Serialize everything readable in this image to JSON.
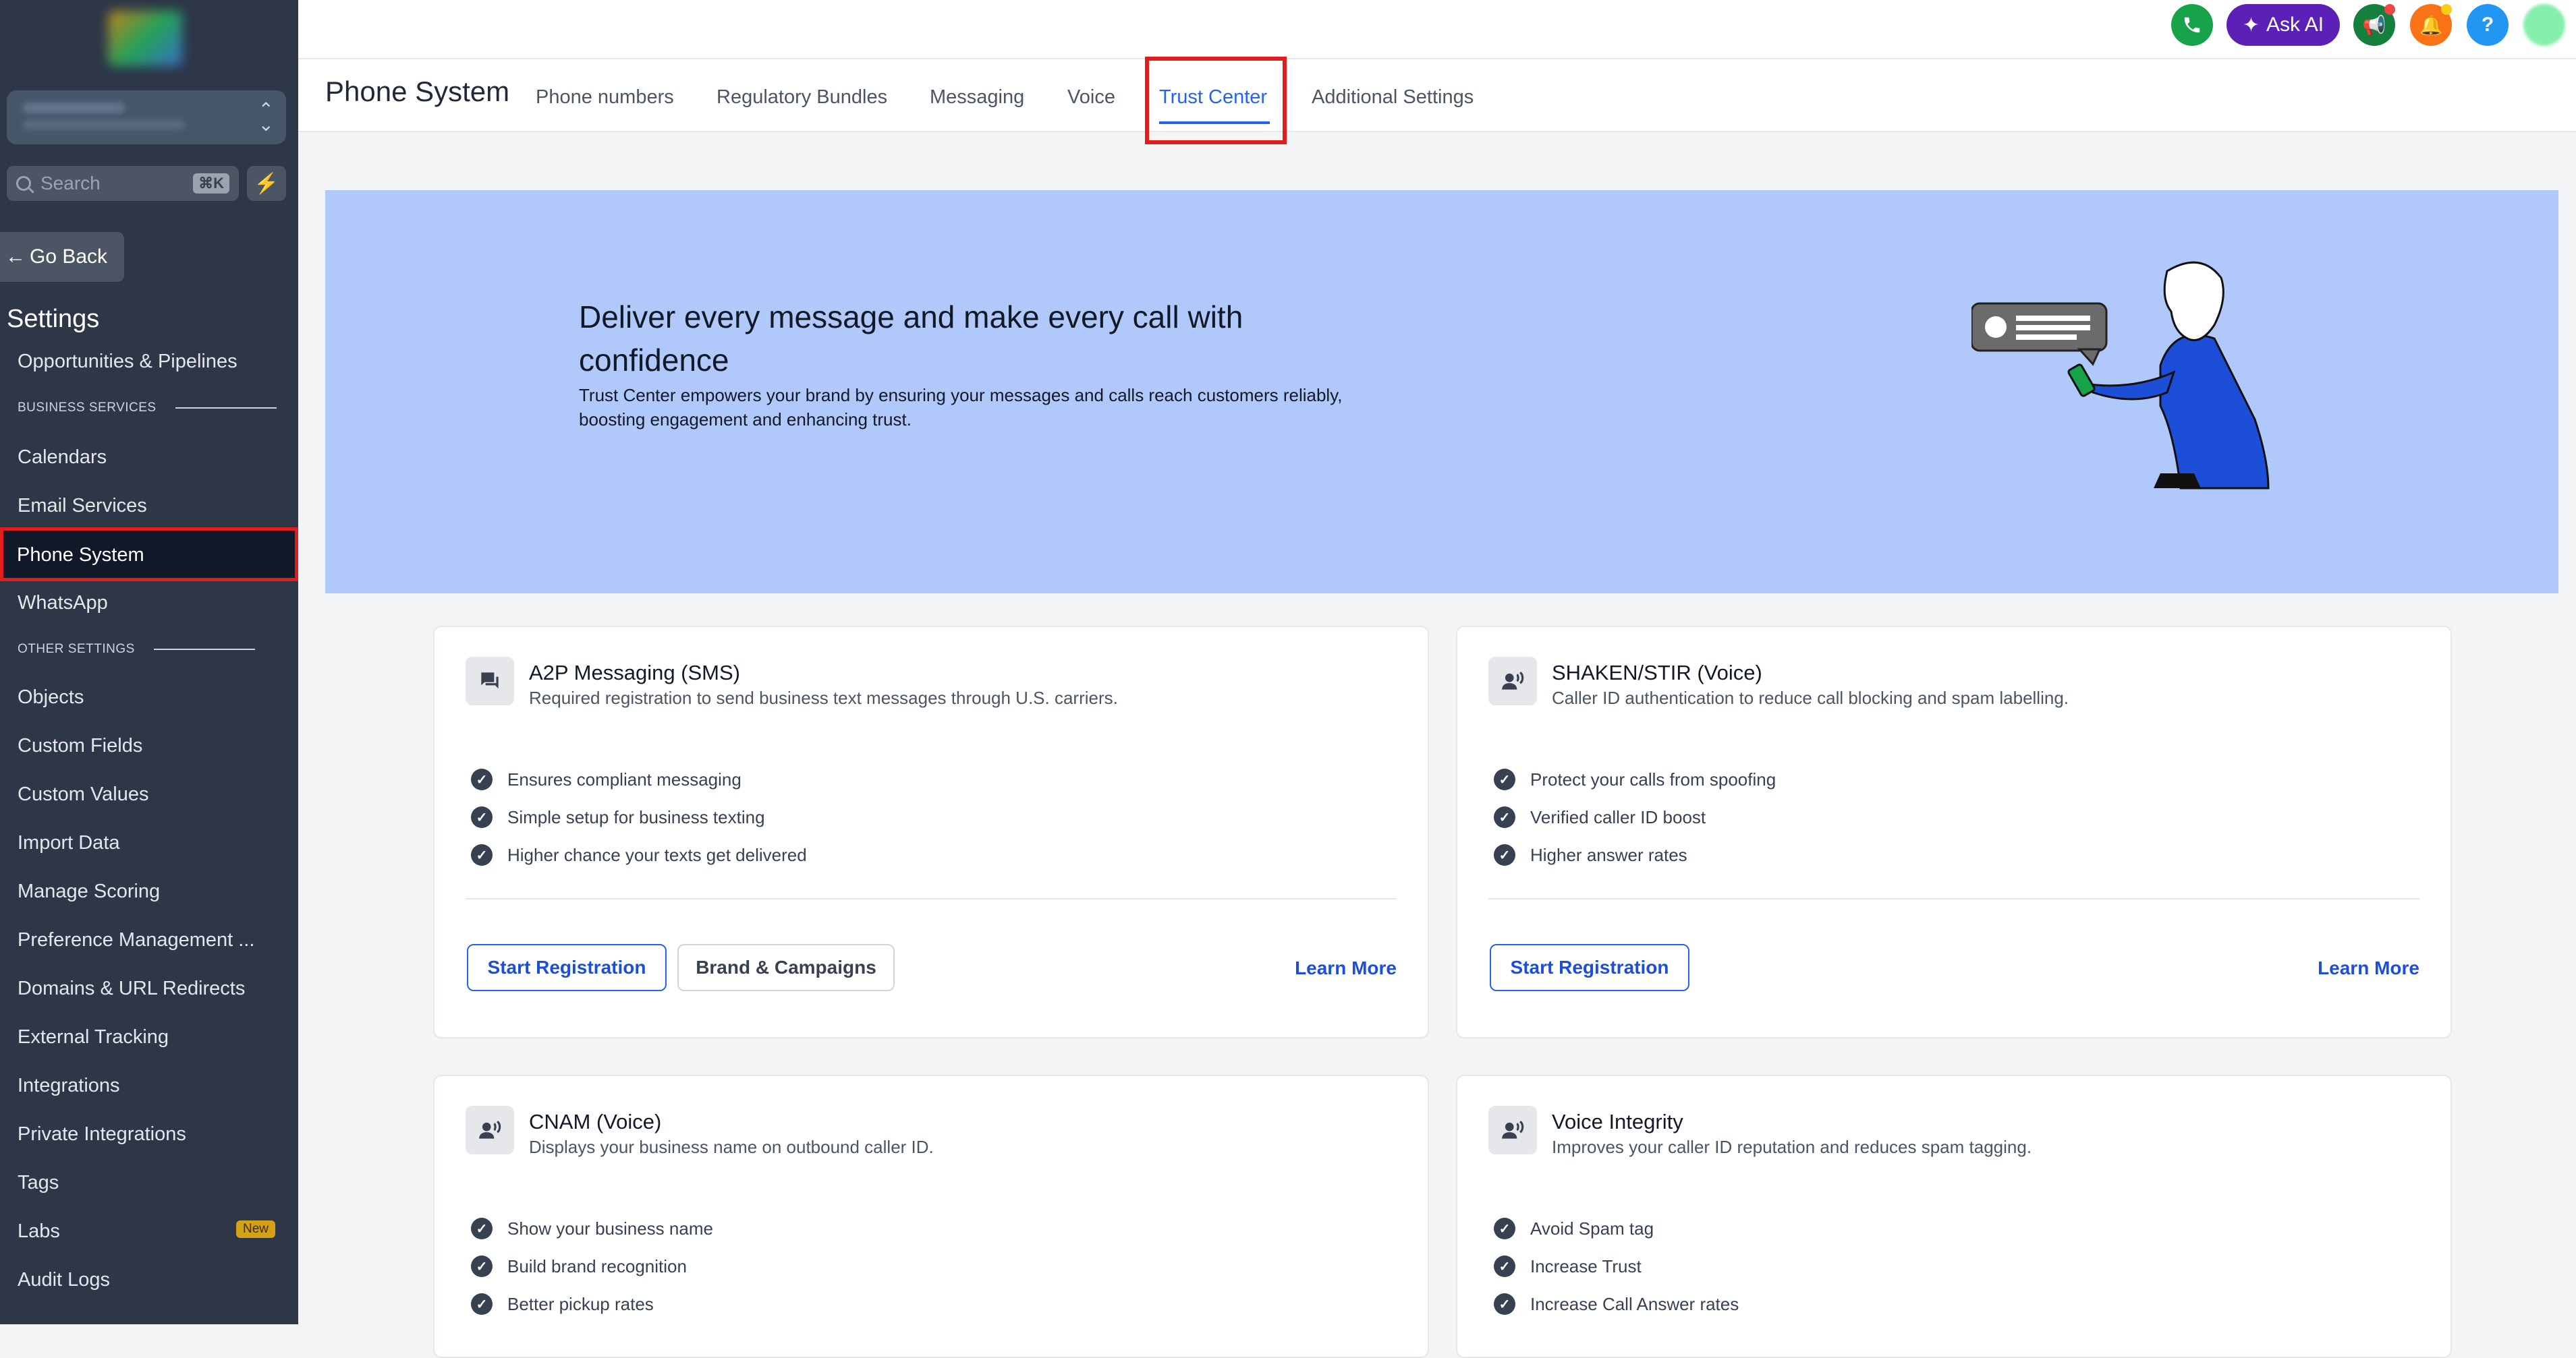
{
  "topbar": {
    "ask_ai_label": "Ask AI",
    "help_label": "?",
    "colors": {
      "phone": "#16a34a",
      "ask_ai": "#5b21b6",
      "announce": "#15803d",
      "bell": "#f97316",
      "help": "#2196f3",
      "avatar": "#86efac"
    }
  },
  "sidebar": {
    "search_placeholder": "Search",
    "search_shortcut": "⌘K",
    "go_back": "Go Back",
    "settings_title": "Settings",
    "items_top": [
      "Opportunities & Pipelines"
    ],
    "section_business": "BUSINESS SERVICES",
    "items_business": [
      "Calendars",
      "Email Services",
      "Phone System",
      "WhatsApp"
    ],
    "section_other": "OTHER SETTINGS",
    "items_other": [
      "Objects",
      "Custom Fields",
      "Custom Values",
      "Import Data",
      "Manage Scoring",
      "Preference Management ...",
      "Domains & URL Redirects",
      "External Tracking",
      "Integrations",
      "Private Integrations",
      "Tags",
      "Labs",
      "Audit Logs"
    ],
    "labs_badge": "New"
  },
  "header": {
    "title": "Phone System",
    "tabs": [
      "Phone numbers",
      "Regulatory Bundles",
      "Messaging",
      "Voice",
      "Trust Center",
      "Additional Settings"
    ],
    "active_tab": "Trust Center"
  },
  "hero": {
    "title": "Deliver every message and make every call with confidence",
    "subtitle": "Trust Center empowers your brand by ensuring your messages and calls reach customers reliably, boosting engagement and enhancing trust."
  },
  "cards": [
    {
      "title": "A2P Messaging (SMS)",
      "subtitle": "Required registration to send business text messages through U.S. carriers.",
      "features": [
        "Ensures compliant messaging",
        "Simple setup for business texting",
        "Higher chance your texts get delivered"
      ],
      "primary": "Start Registration",
      "secondary": "Brand & Campaigns",
      "learn": "Learn More"
    },
    {
      "title": "SHAKEN/STIR (Voice)",
      "subtitle": "Caller ID authentication to reduce call blocking and spam labelling.",
      "features": [
        "Protect your calls from spoofing",
        "Verified caller ID boost",
        "Higher answer rates"
      ],
      "primary": "Start Registration",
      "learn": "Learn More"
    },
    {
      "title": "CNAM (Voice)",
      "subtitle": "Displays your business name on outbound caller ID.",
      "features": [
        "Show your business name",
        "Build brand recognition",
        "Better pickup rates"
      ]
    },
    {
      "title": "Voice Integrity",
      "subtitle": "Improves your caller ID reputation and reduces spam tagging.",
      "features": [
        "Avoid Spam tag",
        "Increase Trust",
        "Increase Call Answer rates"
      ]
    }
  ]
}
